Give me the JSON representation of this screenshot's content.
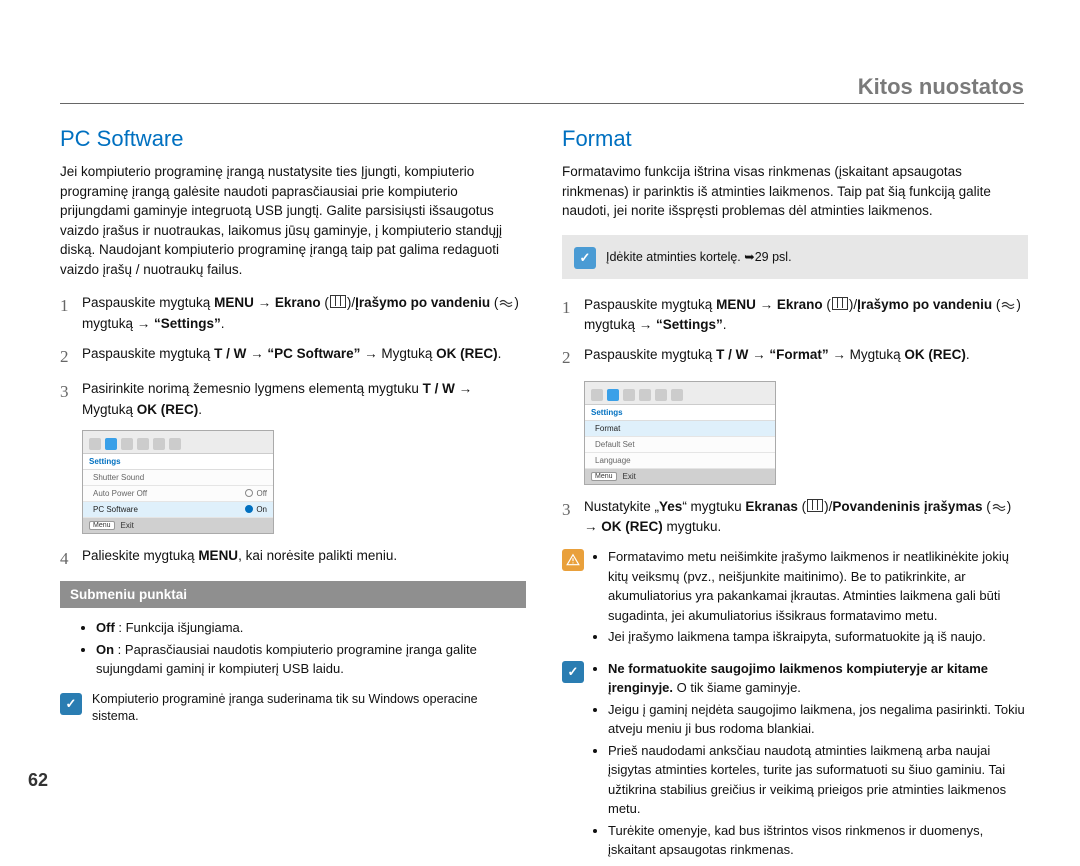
{
  "header": {
    "title": "Kitos nuostatos"
  },
  "page_number": "62",
  "left": {
    "title": "PC Software",
    "intro": "Jei kompiuterio programinę įrangą nustatysite ties Įjungti, kompiuterio programinę įrangą galėsite naudoti paprasčiausiai prie kompiuterio prijungdami gaminyje integruotą USB jungtį. Galite parsisiųsti išsaugotus vaizdo įrašus ir nuotraukas, laikomus jūsų gaminyje, į kompiuterio standųjį diską. Naudojant kompiuterio programinę įrangą taip pat galima redaguoti vaizdo įrašų / nuotraukų failus.",
    "step1_a": "Paspauskite mygtuką ",
    "step1_menu": "MENU",
    "step1_b": " → ",
    "step1_ekrano": "Ekrano",
    "step1_c": " (",
    "step1_d": ")/",
    "step1_irasymo": "Įrašymo po vandeniu",
    "step1_e": " (",
    "step1_f": ") mygtuką  → ",
    "step1_settings": "“Settings”",
    "step1_g": ".",
    "step2_a": "Paspauskite mygtuką ",
    "step2_tw": "T / W",
    "step2_b": " → ",
    "step2_pcsoft": "“PC Software”",
    "step2_c": " → Mygtuką ",
    "step2_okrec": "OK (REC)",
    "step2_d": ".",
    "step3_a": "Pasirinkite norimą žemesnio lygmens elementą mygtuku ",
    "step3_tw": "T / W",
    "step3_b": " → Mygtuką ",
    "step3_okrec": "OK (REC)",
    "step3_c": ".",
    "step4_a": "Palieskite mygtuką ",
    "step4_menu": "MENU",
    "step4_b": ", kai norėsite palikti meniu.",
    "submenu_title": "Submeniu punktai",
    "sub_off_label": "Off",
    "sub_off_text": " : Funkcija išjungiama.",
    "sub_on_label": "On",
    "sub_on_text": " : Paprasčiausiai naudotis kompiuterio programine įranga galite sujungdami gaminį ir kompiuterį USB laidu.",
    "foot_note": "Kompiuterio programinė įranga suderinama tik su Windows operacine sistema.",
    "scr": {
      "title": "Settings",
      "rows": [
        {
          "label": "Shutter Sound",
          "opt": ""
        },
        {
          "label": "Auto Power Off",
          "opt": "Off"
        },
        {
          "label": "PC Software",
          "opt": "On",
          "sel": true
        }
      ],
      "exit": "Exit",
      "menu": "Menu"
    }
  },
  "right": {
    "title": "Format",
    "intro": "Formatavimo funkcija ištrina visas rinkmenas (įskaitant apsaugotas rinkmenas) ir parinktis iš atminties laikmenos. Taip pat šią funkciją galite naudoti, jei norite išspręsti problemas dėl atminties laikmenos.",
    "grey_note": "Įdėkite atminties kortelę. ➥29 psl.",
    "step1_a": "Paspauskite mygtuką ",
    "step1_menu": "MENU",
    "step1_b": " → ",
    "step1_ekrano": "Ekrano",
    "step1_c": " (",
    "step1_d": ")/",
    "step1_irasymo": "Įrašymo po vandeniu",
    "step1_e": " (",
    "step1_f": ") mygtuką → ",
    "step1_settings": "“Settings”",
    "step1_g": ".",
    "step2_a": "Paspauskite mygtuką ",
    "step2_tw": "T / W",
    "step2_b": " → ",
    "step2_format": "“Format”",
    "step2_c": " → Mygtuką ",
    "step2_okrec": "OK (REC)",
    "step2_d": ".",
    "step3_a": "Nustatykite „",
    "step3_yes": "Yes",
    "step3_b": "“ mygtuku ",
    "step3_ekranas": "Ekranas",
    "step3_c": " (",
    "step3_d": ")/",
    "step3_pov": "Povandeninis įrašymas",
    "step3_e": " (",
    "step3_f": ") → ",
    "step3_okrec": "OK (REC)",
    "step3_g": " mygtuku.",
    "warn1": "Formatavimo metu neišimkite įrašymo laikmenos ir neatlikinėkite jokių kitų veiksmų (pvz., neišjunkite maitinimo). Be to patikrinkite, ar akumuliatorius yra pakankamai įkrautas. Atminties laikmena gali būti sugadinta, jei akumuliatorius išsikraus formatavimo metu.",
    "warn2": "Jei įrašymo laikmena tampa iškraipyta, suformatuokite ją iš naujo.",
    "info1_a": "Ne formatuokite saugojimo laikmenos kompiuteryje ar kitame įrenginyje.",
    "info1_b": " O tik šiame gaminyje.",
    "info2": "Jeigu į gaminį neįdėta saugojimo laikmena, jos negalima pasirinkti. Tokiu atveju meniu ji bus rodoma blankiai.",
    "info3": "Prieš naudodami anksčiau naudotą atminties laikmeną arba naujai įsigytas atminties korteles, turite jas suformatuoti su šiuo gaminiu. Tai užtikrina stabilius greičius ir veikimą prieigos prie atminties laikmenos metu.",
    "info4": "Turėkite omenyje, kad bus ištrintos visos rinkmenos ir duomenys, įskaitant apsaugotas rinkmenas.",
    "scr": {
      "title": "Settings",
      "rows": [
        {
          "label": "Format",
          "sel": true
        },
        {
          "label": "Default Set"
        },
        {
          "label": "Language"
        }
      ],
      "exit": "Exit",
      "menu": "Menu"
    }
  }
}
